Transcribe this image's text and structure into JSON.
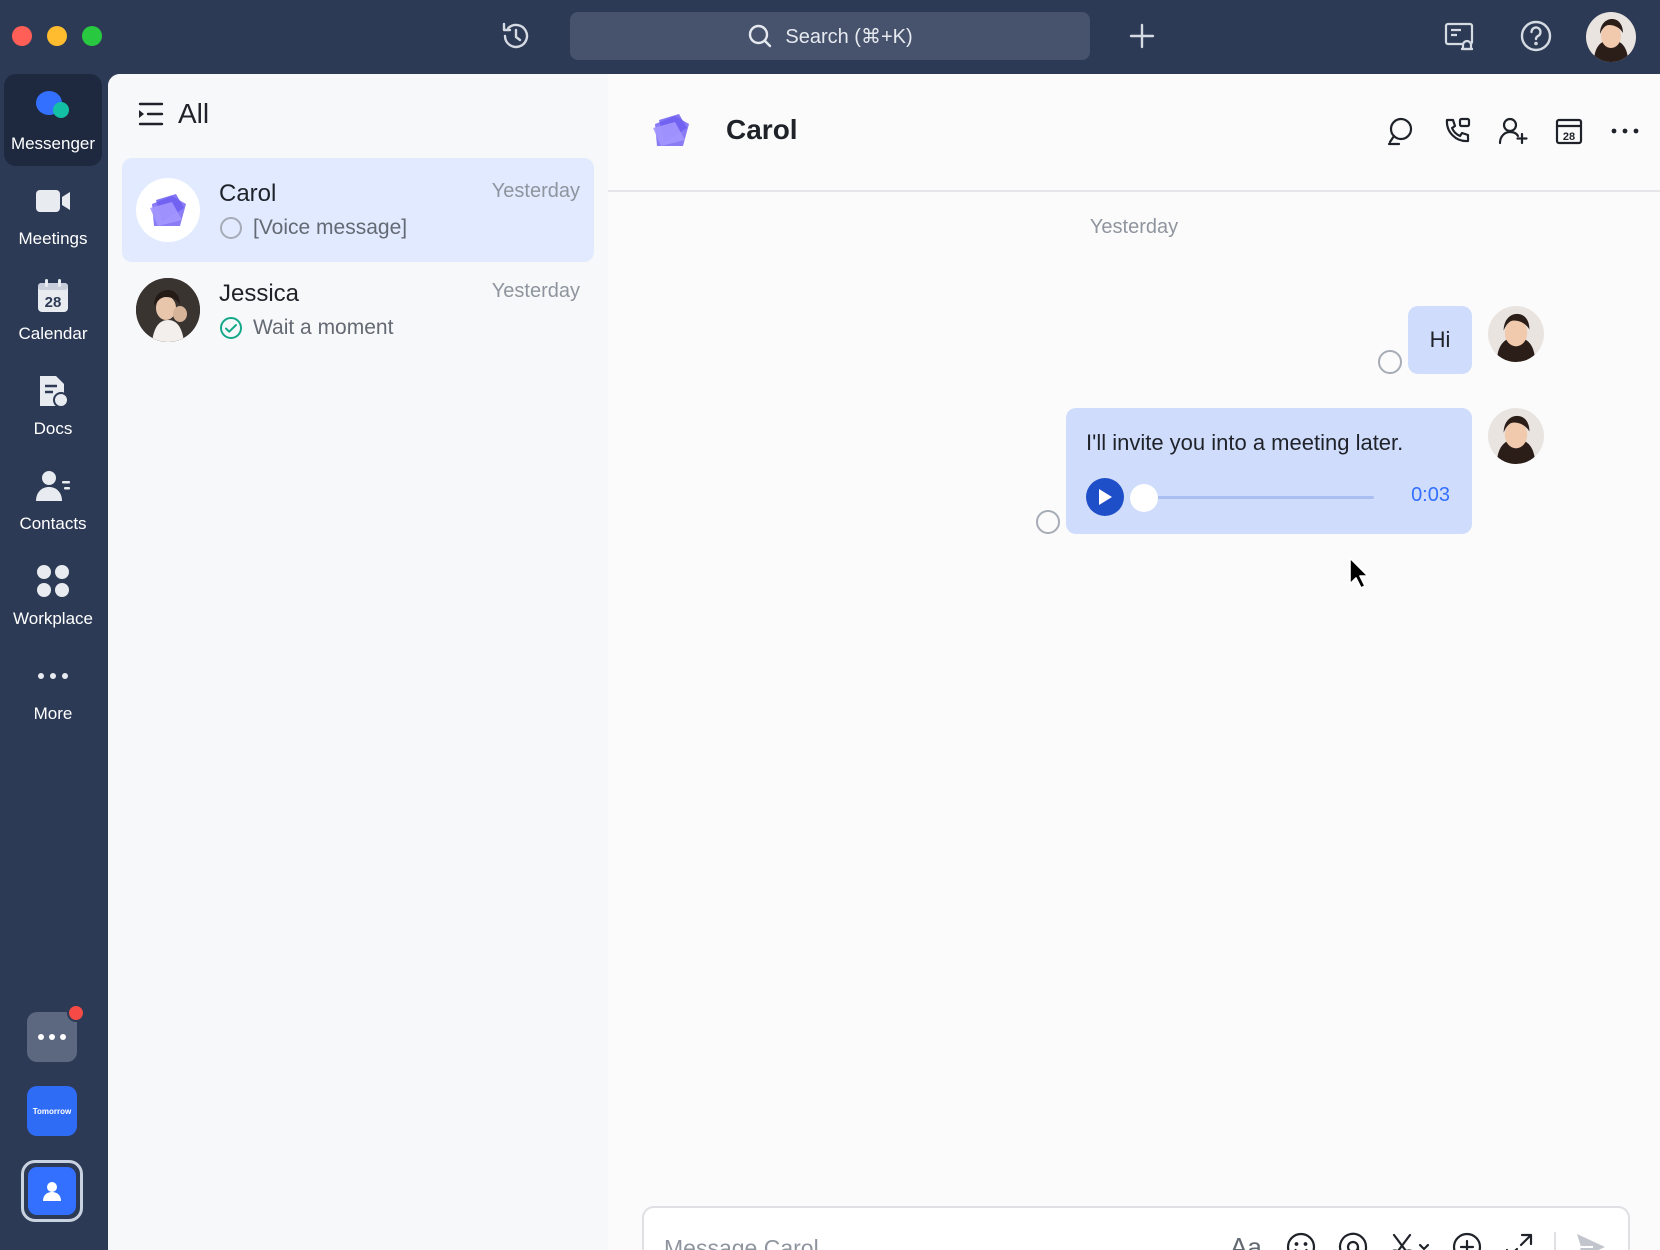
{
  "titlebar": {
    "search_label": "Search (⌘+K)"
  },
  "nav": {
    "items": [
      {
        "label": "Messenger",
        "icon": "messenger-icon"
      },
      {
        "label": "Meetings",
        "icon": "video-camera-icon"
      },
      {
        "label": "Calendar",
        "icon": "calendar-icon",
        "day": "28"
      },
      {
        "label": "Docs",
        "icon": "docs-icon"
      },
      {
        "label": "Contacts",
        "icon": "contacts-icon"
      },
      {
        "label": "Workplace",
        "icon": "workplace-icon"
      },
      {
        "label": "More",
        "icon": "more-dots-icon"
      }
    ],
    "tomorrow_app_label": "Tomorrow"
  },
  "chat_list": {
    "filter_label": "All",
    "conversations": [
      {
        "name": "Carol",
        "time": "Yesterday",
        "preview": "[Voice message]",
        "status": "unread-circle",
        "selected": true
      },
      {
        "name": "Jessica",
        "time": "Yesterday",
        "preview": "Wait a moment",
        "status": "read-check",
        "selected": false
      }
    ]
  },
  "chat": {
    "title": "Carol",
    "date_separator": "Yesterday",
    "messages": [
      {
        "text": "Hi",
        "type": "text"
      },
      {
        "text": "I'll invite you into a meeting later.",
        "type": "voice",
        "duration": "0:03",
        "progress": 0
      }
    ],
    "calendar_day": "28"
  },
  "composer": {
    "placeholder": "Message Carol",
    "font_icon_label": "Aa"
  },
  "colors": {
    "sidebar_bg": "#2c3a55",
    "bubble_bg": "#cfdcfb",
    "accent": "#3370ff",
    "selected_row": "#e1eaff"
  }
}
